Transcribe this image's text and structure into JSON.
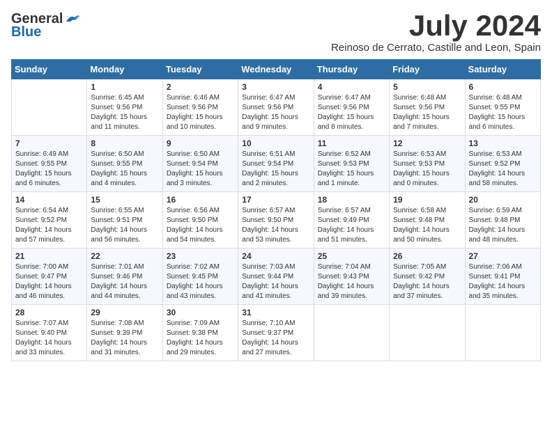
{
  "header": {
    "logo_line1": "General",
    "logo_line2": "Blue",
    "month_title": "July 2024",
    "subtitle": "Reinoso de Cerrato, Castille and Leon, Spain"
  },
  "weekdays": [
    "Sunday",
    "Monday",
    "Tuesday",
    "Wednesday",
    "Thursday",
    "Friday",
    "Saturday"
  ],
  "weeks": [
    [
      {
        "day": "",
        "content": ""
      },
      {
        "day": "1",
        "content": "Sunrise: 6:45 AM\nSunset: 9:56 PM\nDaylight: 15 hours\nand 11 minutes."
      },
      {
        "day": "2",
        "content": "Sunrise: 6:46 AM\nSunset: 9:56 PM\nDaylight: 15 hours\nand 10 minutes."
      },
      {
        "day": "3",
        "content": "Sunrise: 6:47 AM\nSunset: 9:56 PM\nDaylight: 15 hours\nand 9 minutes."
      },
      {
        "day": "4",
        "content": "Sunrise: 6:47 AM\nSunset: 9:56 PM\nDaylight: 15 hours\nand 8 minutes."
      },
      {
        "day": "5",
        "content": "Sunrise: 6:48 AM\nSunset: 9:56 PM\nDaylight: 15 hours\nand 7 minutes."
      },
      {
        "day": "6",
        "content": "Sunrise: 6:48 AM\nSunset: 9:55 PM\nDaylight: 15 hours\nand 6 minutes."
      }
    ],
    [
      {
        "day": "7",
        "content": "Sunrise: 6:49 AM\nSunset: 9:55 PM\nDaylight: 15 hours\nand 6 minutes."
      },
      {
        "day": "8",
        "content": "Sunrise: 6:50 AM\nSunset: 9:55 PM\nDaylight: 15 hours\nand 4 minutes."
      },
      {
        "day": "9",
        "content": "Sunrise: 6:50 AM\nSunset: 9:54 PM\nDaylight: 15 hours\nand 3 minutes."
      },
      {
        "day": "10",
        "content": "Sunrise: 6:51 AM\nSunset: 9:54 PM\nDaylight: 15 hours\nand 2 minutes."
      },
      {
        "day": "11",
        "content": "Sunrise: 6:52 AM\nSunset: 9:53 PM\nDaylight: 15 hours\nand 1 minute."
      },
      {
        "day": "12",
        "content": "Sunrise: 6:53 AM\nSunset: 9:53 PM\nDaylight: 15 hours\nand 0 minutes."
      },
      {
        "day": "13",
        "content": "Sunrise: 6:53 AM\nSunset: 9:52 PM\nDaylight: 14 hours\nand 58 minutes."
      }
    ],
    [
      {
        "day": "14",
        "content": "Sunrise: 6:54 AM\nSunset: 9:52 PM\nDaylight: 14 hours\nand 57 minutes."
      },
      {
        "day": "15",
        "content": "Sunrise: 6:55 AM\nSunset: 9:51 PM\nDaylight: 14 hours\nand 56 minutes."
      },
      {
        "day": "16",
        "content": "Sunrise: 6:56 AM\nSunset: 9:50 PM\nDaylight: 14 hours\nand 54 minutes."
      },
      {
        "day": "17",
        "content": "Sunrise: 6:57 AM\nSunset: 9:50 PM\nDaylight: 14 hours\nand 53 minutes."
      },
      {
        "day": "18",
        "content": "Sunrise: 6:57 AM\nSunset: 9:49 PM\nDaylight: 14 hours\nand 51 minutes."
      },
      {
        "day": "19",
        "content": "Sunrise: 6:58 AM\nSunset: 9:48 PM\nDaylight: 14 hours\nand 50 minutes."
      },
      {
        "day": "20",
        "content": "Sunrise: 6:59 AM\nSunset: 9:48 PM\nDaylight: 14 hours\nand 48 minutes."
      }
    ],
    [
      {
        "day": "21",
        "content": "Sunrise: 7:00 AM\nSunset: 9:47 PM\nDaylight: 14 hours\nand 46 minutes."
      },
      {
        "day": "22",
        "content": "Sunrise: 7:01 AM\nSunset: 9:46 PM\nDaylight: 14 hours\nand 44 minutes."
      },
      {
        "day": "23",
        "content": "Sunrise: 7:02 AM\nSunset: 9:45 PM\nDaylight: 14 hours\nand 43 minutes."
      },
      {
        "day": "24",
        "content": "Sunrise: 7:03 AM\nSunset: 9:44 PM\nDaylight: 14 hours\nand 41 minutes."
      },
      {
        "day": "25",
        "content": "Sunrise: 7:04 AM\nSunset: 9:43 PM\nDaylight: 14 hours\nand 39 minutes."
      },
      {
        "day": "26",
        "content": "Sunrise: 7:05 AM\nSunset: 9:42 PM\nDaylight: 14 hours\nand 37 minutes."
      },
      {
        "day": "27",
        "content": "Sunrise: 7:06 AM\nSunset: 9:41 PM\nDaylight: 14 hours\nand 35 minutes."
      }
    ],
    [
      {
        "day": "28",
        "content": "Sunrise: 7:07 AM\nSunset: 9:40 PM\nDaylight: 14 hours\nand 33 minutes."
      },
      {
        "day": "29",
        "content": "Sunrise: 7:08 AM\nSunset: 9:39 PM\nDaylight: 14 hours\nand 31 minutes."
      },
      {
        "day": "30",
        "content": "Sunrise: 7:09 AM\nSunset: 9:38 PM\nDaylight: 14 hours\nand 29 minutes."
      },
      {
        "day": "31",
        "content": "Sunrise: 7:10 AM\nSunset: 9:37 PM\nDaylight: 14 hours\nand 27 minutes."
      },
      {
        "day": "",
        "content": ""
      },
      {
        "day": "",
        "content": ""
      },
      {
        "day": "",
        "content": ""
      }
    ]
  ]
}
